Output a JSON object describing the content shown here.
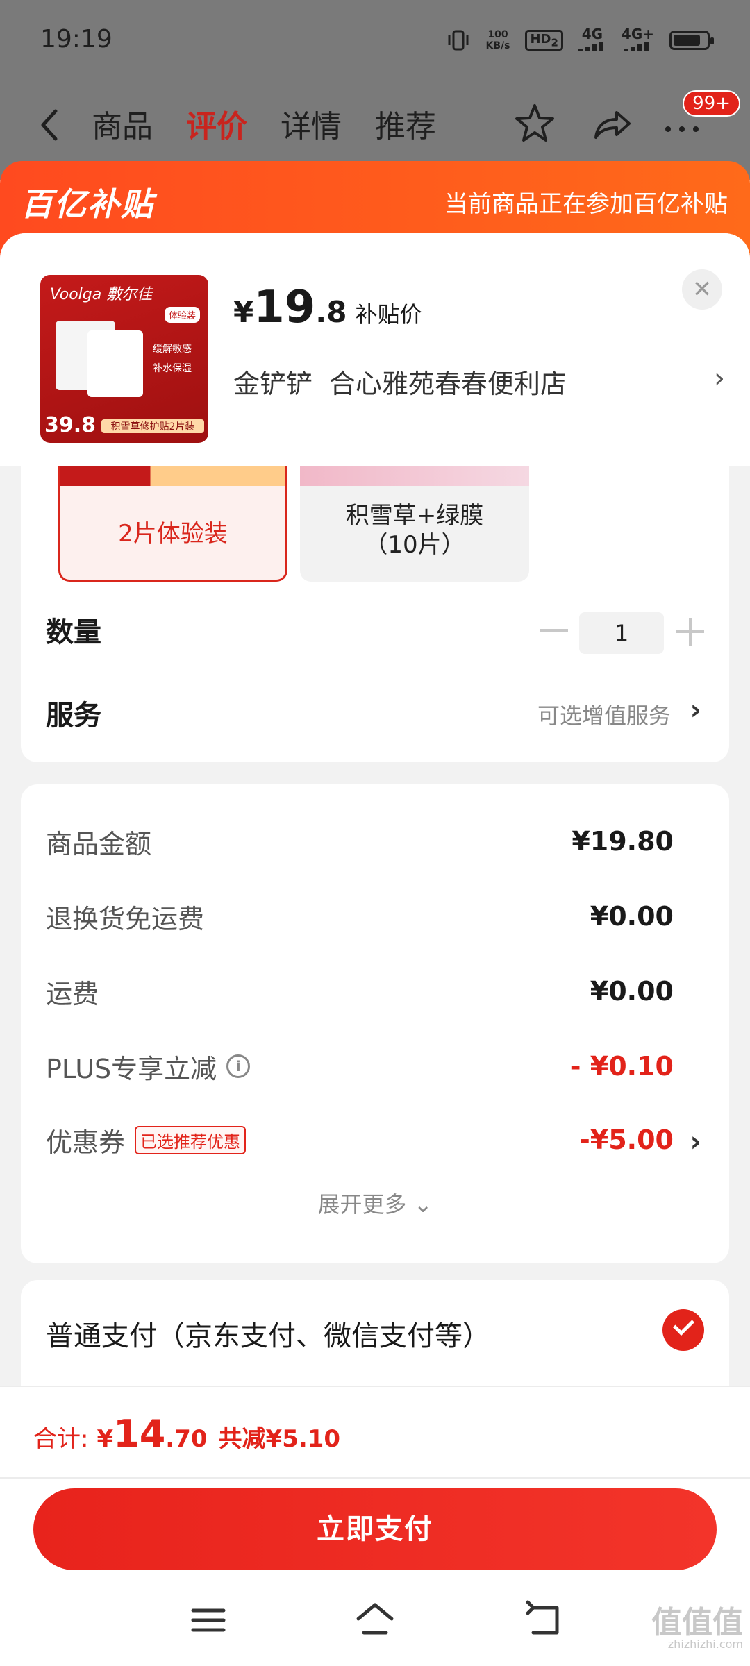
{
  "status_bar": {
    "time": "19:19",
    "net_speed": "100",
    "net_unit": "KB/s",
    "hd_label": "HD",
    "hd_sub": "2",
    "signal1": "4G",
    "signal2": "4G+"
  },
  "nav": {
    "tabs": [
      {
        "label": "商品",
        "active": false
      },
      {
        "label": "评价",
        "active": true
      },
      {
        "label": "详情",
        "active": false
      },
      {
        "label": "推荐",
        "active": false
      }
    ],
    "badge": "99+"
  },
  "banner": {
    "logo": "百亿补贴",
    "text": "当前商品正在参加百亿补贴"
  },
  "product": {
    "thumb_brand": "Voolga 敷尔佳",
    "thumb_tag": "体验装",
    "thumb_bullets": [
      "缓解敏感",
      "补水保湿"
    ],
    "thumb_price": "39.8",
    "thumb_label": "积雪草修护贴2片装",
    "price_currency": "¥",
    "price_int": "19",
    "price_dec": ".8",
    "price_note": "补贴价",
    "shop_level": "金铲铲",
    "shop_name": "合心雅苑春春便利店"
  },
  "options": [
    {
      "label": "2片体验装",
      "selected": true
    },
    {
      "label": "积雪草+绿膜\n（10片）",
      "selected": false
    }
  ],
  "quantity": {
    "label": "数量",
    "value": "1"
  },
  "service": {
    "label": "服务",
    "value": "可选增值服务"
  },
  "price_lines": [
    {
      "label": "商品金额",
      "value": "¥19.80",
      "red": false
    },
    {
      "label": "退换货免运费",
      "value": "¥0.00",
      "red": false
    },
    {
      "label": "运费",
      "value": "¥0.00",
      "red": false
    },
    {
      "label": "PLUS专享立减",
      "value": "- ¥0.10",
      "red": true
    },
    {
      "label": "优惠券",
      "value": "-¥5.00",
      "red": true,
      "tag": "已选推荐优惠"
    }
  ],
  "expand_more": "展开更多",
  "payment": {
    "method": "普通支付（京东支付、微信支付等）"
  },
  "total": {
    "label": "合计:",
    "currency": "¥",
    "int": "14",
    "dec": ".70",
    "saved": "共减¥5.10"
  },
  "pay_button": "立即支付",
  "watermark": {
    "main": "值值值",
    "sub": "zhizhizhi.com"
  },
  "colors": {
    "accent": "#e2231a",
    "banner": "#ff5a1f"
  }
}
